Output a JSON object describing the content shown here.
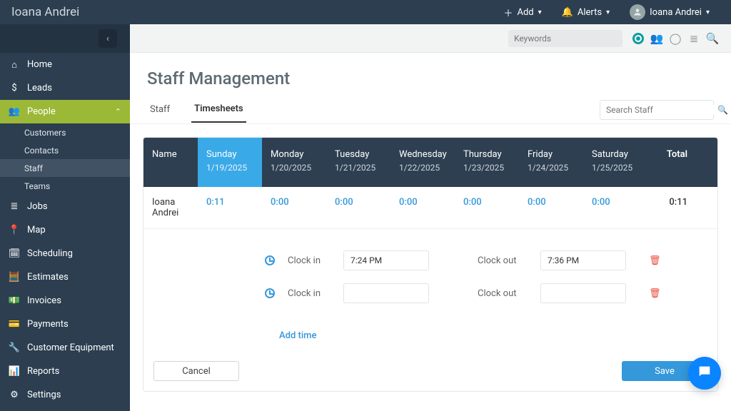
{
  "brand": "Ioana Andrei",
  "topbar": {
    "add_label": "Add",
    "alerts_label": "Alerts",
    "user_label": "Ioana Andrei"
  },
  "sidebar": {
    "items": [
      {
        "label": "Home"
      },
      {
        "label": "Leads"
      },
      {
        "label": "People",
        "active": true
      },
      {
        "label": "Jobs"
      },
      {
        "label": "Map"
      },
      {
        "label": "Scheduling"
      },
      {
        "label": "Estimates"
      },
      {
        "label": "Invoices"
      },
      {
        "label": "Payments"
      },
      {
        "label": "Customer Equipment"
      },
      {
        "label": "Reports"
      },
      {
        "label": "Settings"
      }
    ],
    "people_subs": [
      {
        "label": "Customers"
      },
      {
        "label": "Contacts"
      },
      {
        "label": "Staff",
        "selected": true
      },
      {
        "label": "Teams"
      }
    ]
  },
  "toolbar": {
    "keywords_placeholder": "Keywords"
  },
  "page": {
    "title": "Staff Management"
  },
  "tabs": {
    "staff": "Staff",
    "timesheets": "Timesheets"
  },
  "search": {
    "placeholder": "Search Staff"
  },
  "timesheet": {
    "name_header": "Name",
    "total_header": "Total",
    "days": [
      {
        "day": "Sunday",
        "date": "1/19/2025",
        "highlight": true
      },
      {
        "day": "Monday",
        "date": "1/20/2025"
      },
      {
        "day": "Tuesday",
        "date": "1/21/2025"
      },
      {
        "day": "Wednesday",
        "date": "1/22/2025"
      },
      {
        "day": "Thursday",
        "date": "1/23/2025"
      },
      {
        "day": "Friday",
        "date": "1/24/2025"
      },
      {
        "day": "Saturday",
        "date": "1/25/2025"
      }
    ],
    "row": {
      "name": "Ioana Andrei",
      "values": [
        "0:11",
        "0:00",
        "0:00",
        "0:00",
        "0:00",
        "0:00",
        "0:00"
      ],
      "total": "0:11"
    }
  },
  "entries": {
    "clock_in_label": "Clock in",
    "clock_out_label": "Clock out",
    "rows": [
      {
        "in": "7:24 PM",
        "out": "7:36 PM"
      },
      {
        "in": "",
        "out": ""
      }
    ],
    "add_time": "Add time"
  },
  "buttons": {
    "cancel": "Cancel",
    "save": "Save"
  }
}
